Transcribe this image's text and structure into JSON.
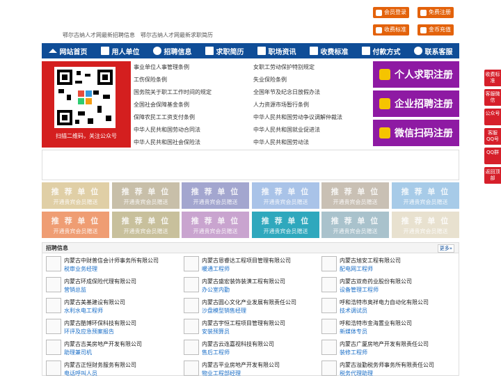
{
  "top_buttons": {
    "login": "会员登录",
    "register": "免费注册",
    "fee": "收费标准",
    "recharge": "金币充值"
  },
  "top_links": [
    "鄂尔古纳人才网最新招聘信息",
    "鄂尔古纳人才网最新求职简历"
  ],
  "nav": [
    "网站首页",
    "用人单位",
    "招聘信息",
    "求职简历",
    "职场资讯",
    "收费标准",
    "付款方式",
    "联系客服"
  ],
  "qr": {
    "caption": "扫描二维码，关注公众号"
  },
  "policy_links": {
    "left": [
      "事业单位人事管理条例",
      "工伤保险条例",
      "国务院关于职工工作时间的规定",
      "全国社会保障基金条例",
      "保障农民工工资支付条例",
      "中华人民共和国劳动合同法",
      "中华人民共和国社会保险法"
    ],
    "right": [
      "女职工劳动保护特别规定",
      "失业保险条例",
      "全国年节及纪念日放假办法",
      "人力资源市场暂行条例",
      "中华人民共和国劳动争议调解仲裁法",
      "中华人民共和国就业促进法",
      "中华人民共和国劳动法"
    ]
  },
  "register_buttons": [
    "个人求职注册",
    "企业招聘注册",
    "微信扫码注册"
  ],
  "recommend": {
    "title": "推 荐 单 位",
    "subtitle": "开通贵宾会员赠送",
    "colors": [
      "#e0cfa6",
      "#c8bfa9",
      "#a3a6cf",
      "#a9c3e8",
      "#c9c0b4",
      "#a7cbe8",
      "#ef9d73",
      "#c8c09c",
      "#c9a4cf",
      "#2fa8bd",
      "#a9c2cc",
      "#e8e1cf"
    ]
  },
  "jobs_section": {
    "title": "招聘信息",
    "more": "更多»",
    "columns": [
      [
        {
          "company": "内蒙古中财普信会计师事务所有限公司",
          "position": "税审业务经理"
        },
        {
          "company": "内蒙古环成保险代理有限公司",
          "position": "营销总监"
        },
        {
          "company": "内蒙古美基建设有限公司",
          "position": "水利水电工程师"
        },
        {
          "company": "内蒙古酷博环保科技有限公司",
          "position": "环评及应急预案报告"
        },
        {
          "company": "内蒙古吉美房地产开发有限公司",
          "position": "助理兼司机"
        },
        {
          "company": "内蒙古正恒财务服务有限公司",
          "position": "电话呼叫人员"
        }
      ],
      [
        {
          "company": "内蒙古恩睿达工程项目管理有限公司",
          "position": "暖通工程师"
        },
        {
          "company": "内蒙古盛宏装饰装潢工程有限公司",
          "position": "办公室内勤"
        },
        {
          "company": "内蒙古圆心文化产业发展有限责任公司",
          "position": "沙盘模型销售经理"
        },
        {
          "company": "内蒙古宇恒工程项目管理有限公司",
          "position": "安装预算员"
        },
        {
          "company": "内蒙古云连嘉视科技有限公司",
          "position": "售后工程师"
        },
        {
          "company": "内蒙古平业房地产开发有限公司",
          "position": "物业工程部经理"
        }
      ],
      [
        {
          "company": "内蒙古旭安工程有限公司",
          "position": "配电网工程师"
        },
        {
          "company": "内蒙古双奇药业股份有限公司",
          "position": "设备管理工程师"
        },
        {
          "company": "呼和浩特市奥祥电力自动化有限公司",
          "position": "技术调试员"
        },
        {
          "company": "呼和浩特市金海置业有限公司",
          "position": "新媒体专员"
        },
        {
          "company": "内蒙古广厦房地产开发有限责任公司",
          "position": "装修工程师"
        },
        {
          "company": "内蒙古溢勤税务师事务所有限责任公司",
          "position": "税务代理助理"
        }
      ]
    ]
  },
  "side_buttons": [
    "收费标准",
    "客服微信",
    "公众号",
    "客服QQ号",
    "QQ群",
    "返回顶部"
  ]
}
